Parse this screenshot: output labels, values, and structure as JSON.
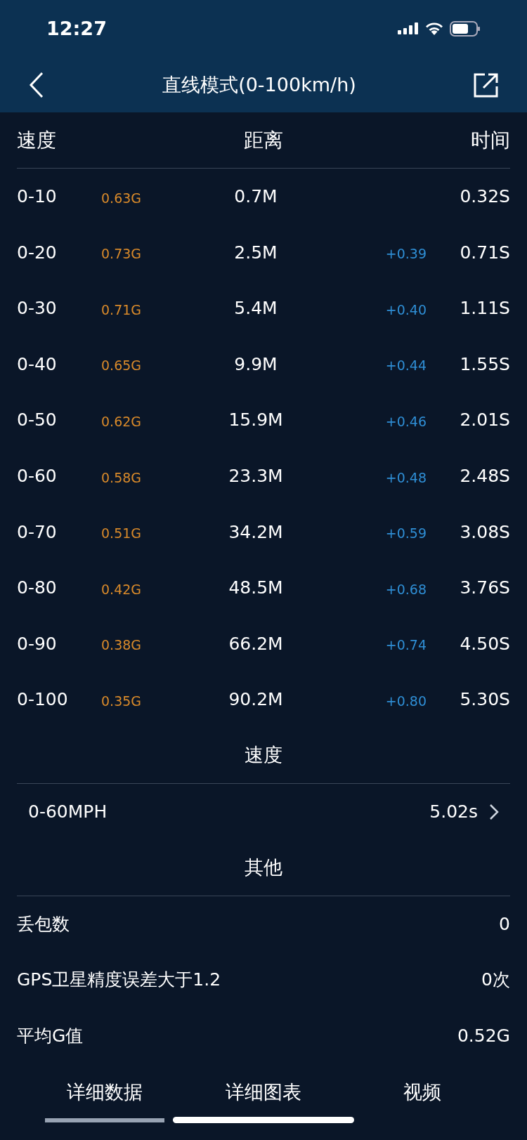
{
  "status_bar": {
    "time": "12:27"
  },
  "header": {
    "title": "直线模式(0-100km/h)"
  },
  "table": {
    "columns": [
      "速度",
      "距离",
      "时间"
    ],
    "rows": [
      {
        "speed": "0-10",
        "g": "0.63G",
        "distance": "0.7M",
        "time": "0.32S"
      },
      {
        "speed": "0-20",
        "g": "0.73G",
        "distance": "2.5M",
        "delta": "+0.39",
        "time": "0.71S"
      },
      {
        "speed": "0-30",
        "g": "0.71G",
        "distance": "5.4M",
        "delta": "+0.40",
        "time": "1.11S"
      },
      {
        "speed": "0-40",
        "g": "0.65G",
        "distance": "9.9M",
        "delta": "+0.44",
        "time": "1.55S"
      },
      {
        "speed": "0-50",
        "g": "0.62G",
        "distance": "15.9M",
        "delta": "+0.46",
        "time": "2.01S"
      },
      {
        "speed": "0-60",
        "g": "0.58G",
        "distance": "23.3M",
        "delta": "+0.48",
        "time": "2.48S"
      },
      {
        "speed": "0-70",
        "g": "0.51G",
        "distance": "34.2M",
        "delta": "+0.59",
        "time": "3.08S"
      },
      {
        "speed": "0-80",
        "g": "0.42G",
        "distance": "48.5M",
        "delta": "+0.68",
        "time": "3.76S"
      },
      {
        "speed": "0-90",
        "g": "0.38G",
        "distance": "66.2M",
        "delta": "+0.74",
        "time": "4.50S"
      },
      {
        "speed": "0-100",
        "g": "0.35G",
        "distance": "90.2M",
        "delta": "+0.80",
        "time": "5.30S"
      }
    ]
  },
  "sections": [
    {
      "title": "速度",
      "rows": [
        {
          "label": "0-60MPH",
          "value": "5.02s",
          "kind": "link"
        }
      ]
    },
    {
      "title": "其他",
      "rows": [
        {
          "label": "丢包数",
          "value": "0",
          "kind": "plain"
        },
        {
          "label": "GPS卫星精度误差大于1.2",
          "value": "0次",
          "kind": "plain"
        },
        {
          "label": "平均G值",
          "value": "0.52G",
          "kind": "plain"
        }
      ]
    }
  ],
  "tabs": [
    {
      "label": "详细数据",
      "selected": true
    },
    {
      "label": "详细图表",
      "selected": false
    },
    {
      "label": "视频",
      "selected": false
    }
  ]
}
